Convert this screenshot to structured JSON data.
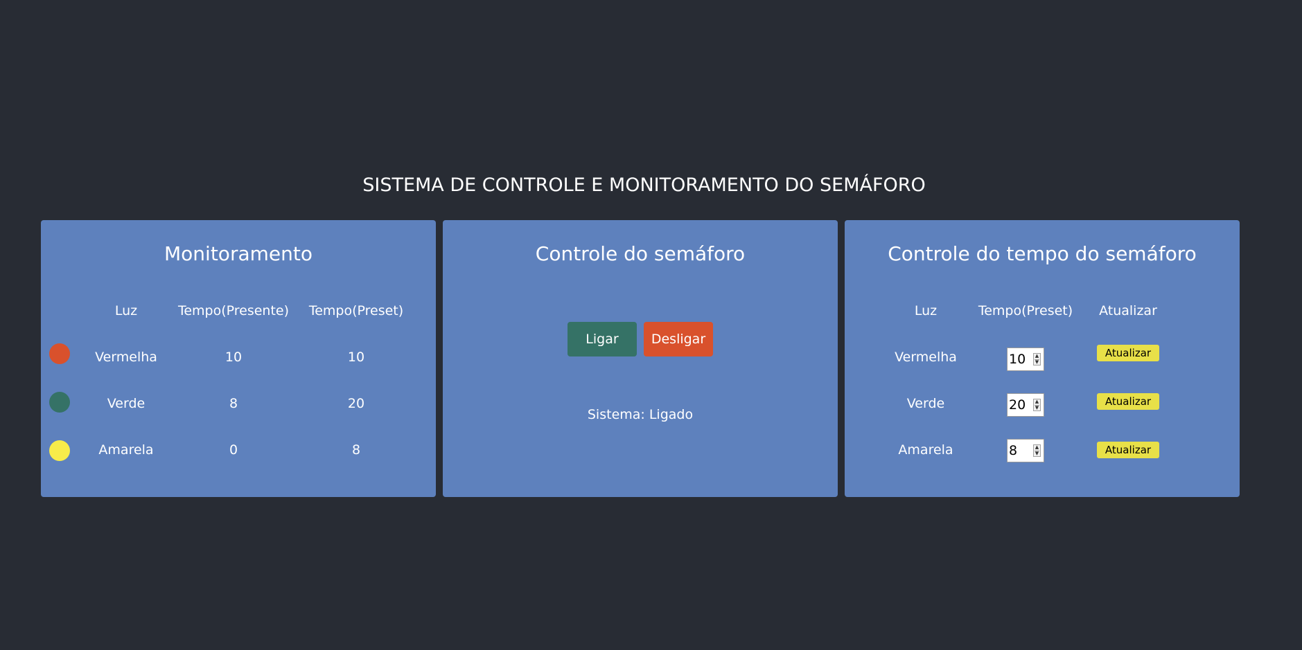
{
  "page": {
    "title": "SISTEMA DE CONTROLE E MONITORAMENTO DO SEMÁFORO"
  },
  "monitor": {
    "title": "Monitoramento",
    "headers": [
      "Luz",
      "Tempo(Presente)",
      "Tempo(Preset)"
    ],
    "rows": [
      {
        "luz": "Vermelha",
        "presente": "10",
        "preset": "10",
        "color": "#d9512c"
      },
      {
        "luz": "Verde",
        "presente": "8",
        "preset": "20",
        "color": "#357266"
      },
      {
        "luz": "Amarela",
        "presente": "0",
        "preset": "8",
        "color": "#f7ec4a"
      }
    ]
  },
  "control": {
    "title": "Controle do semáforo",
    "on_label": "Ligar",
    "off_label": "Desligar",
    "on_color": "#357266",
    "off_color": "#d9512c",
    "status": "Sistema: Ligado"
  },
  "time_control": {
    "title": "Controle do tempo do semáforo",
    "headers": [
      "Luz",
      "Tempo(Preset)",
      "Atualizar"
    ],
    "rows": [
      {
        "luz": "Vermelha",
        "value": "10",
        "button": "Atualizar"
      },
      {
        "luz": "Verde",
        "value": "20",
        "button": "Atualizar"
      },
      {
        "luz": "Amarela",
        "value": "8",
        "button": "Atualizar"
      }
    ],
    "button_color": "#e8e048"
  }
}
